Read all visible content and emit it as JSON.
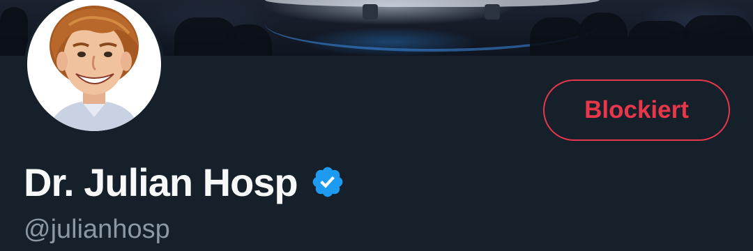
{
  "profile": {
    "display_name": "Dr. Julian Hosp",
    "handle": "@julianhosp",
    "verified": true,
    "block_button_label": "Blockiert"
  },
  "banner": {
    "icon": "concert-stage-photo"
  },
  "avatar": {
    "icon": "profile-caricature"
  },
  "colors": {
    "background": "#15202b",
    "name_text": "#f7f9f9",
    "handle_text": "#8b98a5",
    "blocked_accent": "#e8364a",
    "verified_badge": "#1d9bf0"
  }
}
